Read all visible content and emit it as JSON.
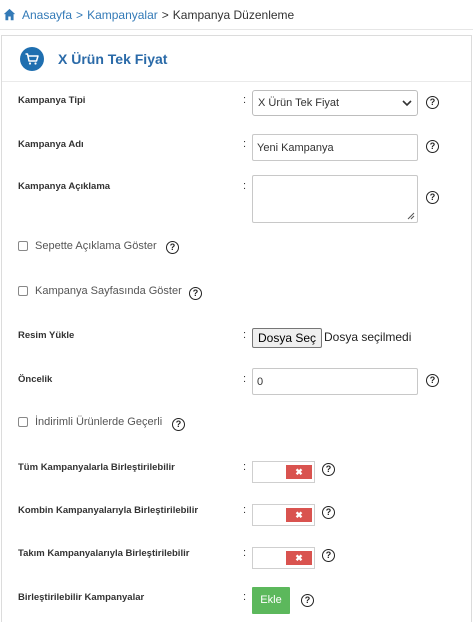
{
  "breadcrumb": {
    "items": [
      "Anasayfa",
      "Kampanyalar",
      "Kampanya Düzenleme"
    ],
    "separator": ">"
  },
  "panel": {
    "title": "X Ürün Tek Fiyat",
    "icon": "cart-icon"
  },
  "form": {
    "colon": ":",
    "help_glyph": "?",
    "campaign_type": {
      "label": "Kampanya Tipi",
      "value": "X Ürün Tek Fiyat"
    },
    "campaign_name": {
      "label": "Kampanya Adı",
      "value": "Yeni Kampanya"
    },
    "campaign_description": {
      "label": "Kampanya Açıklama",
      "value": ""
    },
    "show_description_in_cart": {
      "label": "Sepette Açıklama Göster",
      "checked": false
    },
    "show_on_campaign_page": {
      "label": "Kampanya Sayfasında Göster",
      "checked": false
    },
    "image_upload": {
      "label": "Resim Yükle",
      "button": "Dosya Seç",
      "status": "Dosya seçilmedi"
    },
    "priority": {
      "label": "Öncelik",
      "value": "0"
    },
    "valid_on_discounted": {
      "label": "İndirimli Ürünlerde Geçerli",
      "checked": false
    },
    "combinable_all": {
      "label": "Tüm Kampanyalarla Birleştirilebilir",
      "state": "off",
      "off_glyph": "✖"
    },
    "combinable_combo": {
      "label": "Kombin Kampanyalarıyla Birleştirilebilir",
      "state": "off",
      "off_glyph": "✖"
    },
    "combinable_set": {
      "label": "Takım Kampanyalarıyla Birleştirilebilir",
      "state": "off",
      "off_glyph": "✖"
    },
    "combinable_campaigns": {
      "label": "Birleştirilebilir Kampanyalar",
      "button": "Ekle"
    }
  },
  "colors": {
    "link": "#337ab7",
    "title": "#2a6aa8",
    "badge": "#1f6fb0",
    "toggle_off": "#d9534f",
    "add_button": "#5cb85c"
  }
}
